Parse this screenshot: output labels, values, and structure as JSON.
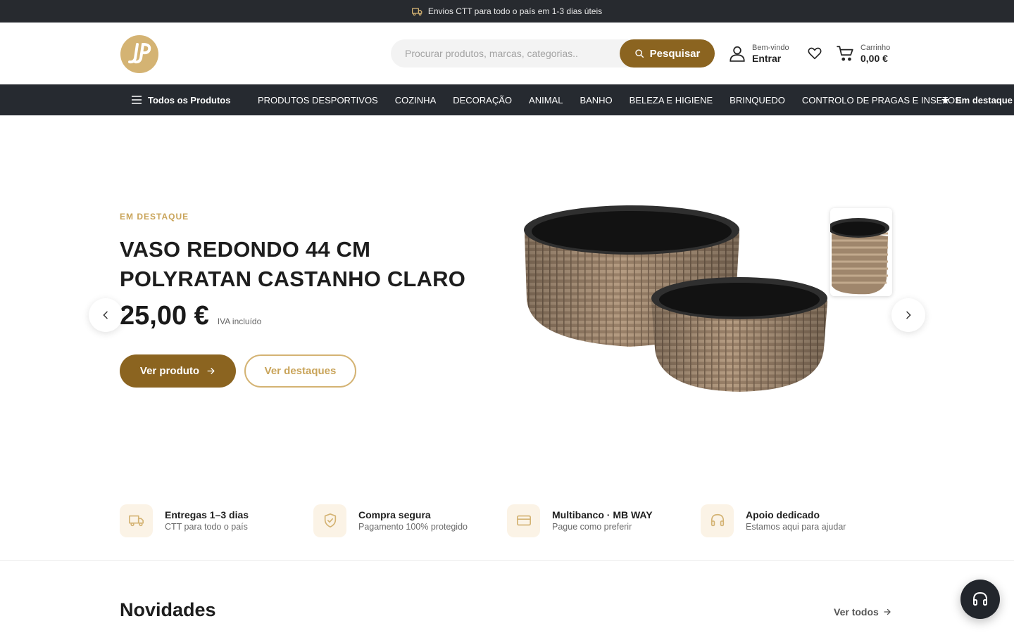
{
  "announcement": {
    "text": "Envios CTT para todo o país em 1-3 dias úteis",
    "icon": "truck-icon"
  },
  "header": {
    "logo_icon": "brand-logo",
    "search": {
      "placeholder": "Procurar produtos, marcas, categorias..",
      "value": "",
      "button_label": "Pesquisar"
    },
    "account": {
      "greeting": "Bem-vindo",
      "action": "Entrar"
    },
    "cart": {
      "label": "Carrinho",
      "total": "0,00 €"
    }
  },
  "nav": {
    "all_products": "Todos os Produtos",
    "items": [
      "PRODUTOS DESPORTIVOS",
      "COZINHA",
      "DECORAÇÃO",
      "ANIMAL",
      "BANHO",
      "BELEZA E HIGIENE",
      "BRINQUEDO",
      "CONTROLO DE PRAGAS E INSETOS"
    ],
    "featured": "Em destaque"
  },
  "hero": {
    "eyebrow": "EM DESTAQUE",
    "title": "VASO REDONDO 44 CM POLYRATAN CASTANHO CLARO",
    "price": "25,00 €",
    "vat_note": "IVA incluído",
    "primary_button": "Ver produto",
    "secondary_button": "Ver destaques"
  },
  "features": [
    {
      "icon": "truck-icon",
      "title": "Entregas 1–3 dias",
      "subtitle": "CTT para todo o país"
    },
    {
      "icon": "shield-icon",
      "title": "Compra segura",
      "subtitle": "Pagamento 100% protegido"
    },
    {
      "icon": "credit-card-icon",
      "title": "Multibanco · MB WAY",
      "subtitle": "Pague como preferir"
    },
    {
      "icon": "headphones-icon",
      "title": "Apoio dedicado",
      "subtitle": "Estamos aqui para ajudar"
    }
  ],
  "novidades": {
    "title": "Novidades",
    "see_all": "Ver todos"
  },
  "colors": {
    "accent": "#8b6420",
    "gold": "#c9a45a",
    "dark": "#262a30"
  }
}
